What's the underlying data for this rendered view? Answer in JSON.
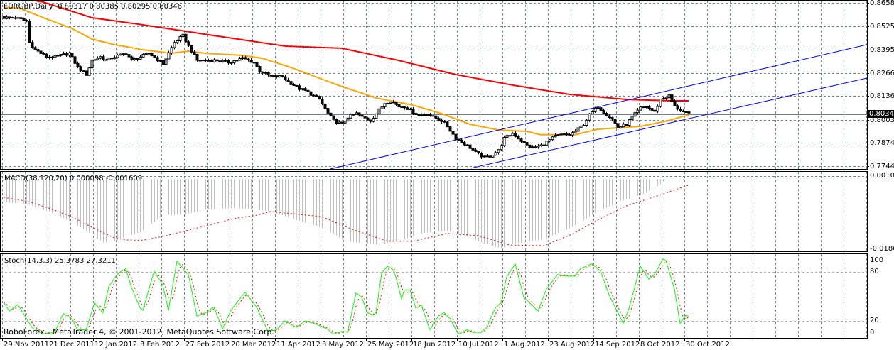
{
  "window": {
    "symbol_label": "EURGBP,Daily",
    "ohlc": "0.80317 0.80385 0.80295 0.80346",
    "copyright": "RoboForex - MetaTrader 4, © 2001-2012, MetaQuotes Software Corp."
  },
  "colors": {
    "bull_body": "#ffffff",
    "bear_body": "#000000",
    "ma_fast": "#ffa500",
    "ma_slow": "#ff0000",
    "channel": "#0000ff",
    "grid": "#708090",
    "macd_hist": "#c0c0c0",
    "signal": "#ff0000",
    "stoch_k": "#00ff00",
    "stoch_d": "#ff0000"
  },
  "price_axis": {
    "labels": [
      "0.86580",
      "0.85250",
      "0.83955",
      "0.82660",
      "0.81365",
      "0.80035",
      "0.78740",
      "0.77445"
    ],
    "current": "0.80346"
  },
  "macd_axis": {
    "labels": [
      "0.00102",
      "-0.01864"
    ]
  },
  "stoch_axis": {
    "labels": [
      "100",
      "80",
      "20",
      "0"
    ]
  },
  "macd": {
    "label": "MACD(38,120,20)",
    "main": "0.000098",
    "signal": "-0.001609"
  },
  "stoch": {
    "label": "Stoch(14,3,3)",
    "k": "25.3783",
    "d": "27.3211"
  },
  "dates": [
    "29 Nov 2011",
    "21 Dec 2011",
    "12 Jan 2012",
    "3 Feb 2012",
    "27 Feb 2012",
    "20 Mar 2012",
    "11 Apr 2012",
    "3 May 2012",
    "25 May 2012",
    "18 Jun 2012",
    "10 Jul 2012",
    "1 Aug 2012",
    "23 Aug 2012",
    "14 Sep 2012",
    "8 Oct 2012",
    "30 Oct 2012"
  ],
  "chart_data": {
    "type": "candlestick",
    "title": "EURGBP,Daily",
    "bars": 242,
    "ylim": [
      0.77445,
      0.8658
    ],
    "close_keyframes": [
      [
        0,
        0.8575
      ],
      [
        4,
        0.8575
      ],
      [
        8,
        0.8555
      ],
      [
        9,
        0.8436
      ],
      [
        11,
        0.8396
      ],
      [
        15,
        0.8356
      ],
      [
        18,
        0.8356
      ],
      [
        23,
        0.8376
      ],
      [
        26,
        0.8297
      ],
      [
        29,
        0.8257
      ],
      [
        31,
        0.8336
      ],
      [
        34,
        0.8356
      ],
      [
        36,
        0.8336
      ],
      [
        39,
        0.8356
      ],
      [
        43,
        0.8376
      ],
      [
        45,
        0.8336
      ],
      [
        48,
        0.8356
      ],
      [
        51,
        0.8376
      ],
      [
        56,
        0.8317
      ],
      [
        60,
        0.8436
      ],
      [
        63,
        0.8475
      ],
      [
        65,
        0.8416
      ],
      [
        68,
        0.8336
      ],
      [
        71,
        0.8336
      ],
      [
        75,
        0.8336
      ],
      [
        79,
        0.8325
      ],
      [
        84,
        0.8348
      ],
      [
        88,
        0.8325
      ],
      [
        90,
        0.8277
      ],
      [
        94,
        0.8245
      ],
      [
        98,
        0.8245
      ],
      [
        100,
        0.8217
      ],
      [
        104,
        0.8178
      ],
      [
        106,
        0.8166
      ],
      [
        109,
        0.8138
      ],
      [
        111,
        0.8118
      ],
      [
        114,
        0.8039
      ],
      [
        116,
        0.7999
      ],
      [
        119,
        0.7979
      ],
      [
        121,
        0.8019
      ],
      [
        124,
        0.8039
      ],
      [
        126,
        0.8019
      ],
      [
        129,
        0.7999
      ],
      [
        131,
        0.8039
      ],
      [
        134,
        0.8098
      ],
      [
        136,
        0.811
      ],
      [
        139,
        0.8078
      ],
      [
        141,
        0.8078
      ],
      [
        144,
        0.8047
      ],
      [
        146,
        0.8027
      ],
      [
        149,
        0.8039
      ],
      [
        151,
        0.8019
      ],
      [
        154,
        0.7999
      ],
      [
        156,
        0.7967
      ],
      [
        159,
        0.79
      ],
      [
        161,
        0.788
      ],
      [
        164,
        0.7848
      ],
      [
        166,
        0.782
      ],
      [
        169,
        0.7793
      ],
      [
        171,
        0.7801
      ],
      [
        174,
        0.7832
      ],
      [
        176,
        0.79
      ],
      [
        179,
        0.7928
      ],
      [
        181,
        0.79
      ],
      [
        184,
        0.786
      ],
      [
        186,
        0.7848
      ],
      [
        189,
        0.786
      ],
      [
        191,
        0.788
      ],
      [
        194,
        0.7912
      ],
      [
        196,
        0.792
      ],
      [
        199,
        0.792
      ],
      [
        201,
        0.7939
      ],
      [
        204,
        0.7979
      ],
      [
        206,
        0.8031
      ],
      [
        209,
        0.8078
      ],
      [
        211,
        0.8047
      ],
      [
        214,
        0.8007
      ],
      [
        216,
        0.7959
      ],
      [
        219,
        0.7979
      ],
      [
        221,
        0.8019
      ],
      [
        224,
        0.807
      ],
      [
        226,
        0.8078
      ],
      [
        229,
        0.8047
      ],
      [
        231,
        0.8118
      ],
      [
        234,
        0.8138
      ],
      [
        236,
        0.8078
      ],
      [
        239,
        0.8047
      ],
      [
        241,
        0.80346
      ]
    ],
    "ma_slow_keyframes": [
      [
        0,
        0.87
      ],
      [
        14,
        0.8662
      ],
      [
        31,
        0.8575
      ],
      [
        49,
        0.8535
      ],
      [
        74,
        0.8475
      ],
      [
        99,
        0.8416
      ],
      [
        119,
        0.8404
      ],
      [
        139,
        0.8336
      ],
      [
        159,
        0.8257
      ],
      [
        179,
        0.8198
      ],
      [
        199,
        0.8146
      ],
      [
        219,
        0.8118
      ],
      [
        234,
        0.811
      ],
      [
        241,
        0.811
      ]
    ],
    "ma_fast_keyframes": [
      [
        0,
        0.8634
      ],
      [
        6,
        0.8626
      ],
      [
        14,
        0.8575
      ],
      [
        24,
        0.8515
      ],
      [
        31,
        0.8456
      ],
      [
        39,
        0.8424
      ],
      [
        49,
        0.8396
      ],
      [
        59,
        0.8376
      ],
      [
        65,
        0.8388
      ],
      [
        71,
        0.8376
      ],
      [
        84,
        0.8364
      ],
      [
        91,
        0.8348
      ],
      [
        101,
        0.8297
      ],
      [
        111,
        0.8237
      ],
      [
        119,
        0.819
      ],
      [
        131,
        0.8126
      ],
      [
        144,
        0.8086
      ],
      [
        154,
        0.8039
      ],
      [
        164,
        0.7979
      ],
      [
        174,
        0.7947
      ],
      [
        184,
        0.7939
      ],
      [
        189,
        0.792
      ],
      [
        201,
        0.792
      ],
      [
        209,
        0.7951
      ],
      [
        216,
        0.7959
      ],
      [
        224,
        0.7967
      ],
      [
        234,
        0.7999
      ],
      [
        239,
        0.8023
      ],
      [
        241,
        0.8027
      ]
    ],
    "channel_lines": [
      [
        [
          115,
          0.7729
        ],
        [
          303.75,
          0.8424
        ]
      ],
      [
        [
          164.5,
          0.7733
        ],
        [
          303.75,
          0.8237
        ]
      ]
    ],
    "macd": {
      "ylim": [
        -0.01864,
        0.00102
      ],
      "hist_keyframes": [
        [
          0,
          -0.0062
        ],
        [
          8,
          -0.0066
        ],
        [
          11,
          -0.0076
        ],
        [
          16,
          -0.0087
        ],
        [
          24,
          -0.0116
        ],
        [
          31,
          -0.0148
        ],
        [
          35,
          -0.0171
        ],
        [
          39,
          -0.0167
        ],
        [
          43,
          -0.0154
        ],
        [
          48,
          -0.0143
        ],
        [
          56,
          -0.0097
        ],
        [
          64,
          -0.0095
        ],
        [
          71,
          -0.0082
        ],
        [
          81,
          -0.0078
        ],
        [
          89,
          -0.0082
        ],
        [
          94,
          -0.0087
        ],
        [
          103,
          -0.011
        ],
        [
          113,
          -0.0133
        ],
        [
          120,
          -0.0167
        ],
        [
          132,
          -0.0177
        ],
        [
          142,
          -0.0158
        ],
        [
          148,
          -0.0144
        ],
        [
          156,
          -0.0139
        ],
        [
          161,
          -0.0148
        ],
        [
          169,
          -0.0173
        ],
        [
          175,
          -0.0186
        ],
        [
          180,
          -0.0173
        ],
        [
          190,
          -0.0162
        ],
        [
          200,
          -0.0129
        ],
        [
          208,
          -0.0091
        ],
        [
          217,
          -0.0059
        ],
        [
          225,
          -0.004
        ],
        [
          230,
          -0.0019
        ],
        [
          233,
          0.0001
        ],
        [
          241,
          9.8e-05
        ]
      ],
      "signal_keyframes": [
        [
          0,
          -0.0049
        ],
        [
          8,
          -0.0059
        ],
        [
          16,
          -0.0078
        ],
        [
          24,
          -0.0101
        ],
        [
          31,
          -0.0129
        ],
        [
          39,
          -0.0158
        ],
        [
          44,
          -0.0164
        ],
        [
          49,
          -0.0164
        ],
        [
          56,
          -0.0154
        ],
        [
          64,
          -0.0139
        ],
        [
          74,
          -0.012
        ],
        [
          81,
          -0.0106
        ],
        [
          89,
          -0.0097
        ],
        [
          94,
          -0.0087
        ],
        [
          112,
          -0.0101
        ],
        [
          122,
          -0.0133
        ],
        [
          135,
          -0.0167
        ],
        [
          144,
          -0.0167
        ],
        [
          156,
          -0.0146
        ],
        [
          167,
          -0.0152
        ],
        [
          178,
          -0.0177
        ],
        [
          190,
          -0.0179
        ],
        [
          200,
          -0.0148
        ],
        [
          209,
          -0.011
        ],
        [
          219,
          -0.0072
        ],
        [
          232,
          -0.004
        ],
        [
          241,
          -0.001609
        ]
      ]
    },
    "stochastic": {
      "ylim": [
        0,
        100
      ],
      "levels": [
        20,
        80
      ],
      "k_keyframes": [
        [
          0,
          43
        ],
        [
          2,
          32
        ],
        [
          5,
          40
        ],
        [
          7,
          29
        ],
        [
          10,
          12
        ],
        [
          14,
          4
        ],
        [
          18,
          6
        ],
        [
          21,
          29
        ],
        [
          24,
          23
        ],
        [
          26,
          9
        ],
        [
          29,
          9
        ],
        [
          32,
          42
        ],
        [
          35,
          30
        ],
        [
          37,
          62
        ],
        [
          40,
          77
        ],
        [
          41,
          80
        ],
        [
          43,
          84
        ],
        [
          45,
          61
        ],
        [
          48,
          36
        ],
        [
          49,
          33
        ],
        [
          53,
          81
        ],
        [
          56,
          64
        ],
        [
          58,
          33
        ],
        [
          61,
          93
        ],
        [
          65,
          77
        ],
        [
          68,
          26
        ],
        [
          71,
          30
        ],
        [
          74,
          37
        ],
        [
          77,
          10
        ],
        [
          80,
          33
        ],
        [
          84,
          51
        ],
        [
          85,
          55
        ],
        [
          89,
          37
        ],
        [
          93,
          7
        ],
        [
          96,
          9
        ],
        [
          99,
          20
        ],
        [
          103,
          12
        ],
        [
          106,
          20
        ],
        [
          110,
          16
        ],
        [
          114,
          10
        ],
        [
          116,
          4
        ],
        [
          119,
          7
        ],
        [
          121,
          6
        ],
        [
          124,
          54
        ],
        [
          126,
          49
        ],
        [
          128,
          30
        ],
        [
          130,
          27
        ],
        [
          131,
          30
        ],
        [
          133,
          78
        ],
        [
          135,
          87
        ],
        [
          137,
          83
        ],
        [
          138,
          74
        ],
        [
          140,
          47
        ],
        [
          141,
          58
        ],
        [
          143,
          58
        ],
        [
          145,
          36
        ],
        [
          147,
          39
        ],
        [
          150,
          9
        ],
        [
          153,
          26
        ],
        [
          155,
          30
        ],
        [
          157,
          23
        ],
        [
          160,
          4
        ],
        [
          163,
          9
        ],
        [
          165,
          6
        ],
        [
          168,
          6
        ],
        [
          170,
          12
        ],
        [
          173,
          36
        ],
        [
          175,
          42
        ],
        [
          177,
          74
        ],
        [
          180,
          90
        ],
        [
          183,
          49
        ],
        [
          186,
          39
        ],
        [
          188,
          32
        ],
        [
          191,
          59
        ],
        [
          195,
          77
        ],
        [
          197,
          75
        ],
        [
          201,
          75
        ],
        [
          203,
          84
        ],
        [
          207,
          90
        ],
        [
          210,
          81
        ],
        [
          213,
          52
        ],
        [
          218,
          17
        ],
        [
          220,
          35
        ],
        [
          224,
          87
        ],
        [
          227,
          71
        ],
        [
          229,
          77
        ],
        [
          232,
          96
        ],
        [
          233,
          94
        ],
        [
          236,
          59
        ],
        [
          238,
          17
        ],
        [
          240,
          27
        ],
        [
          241,
          25.3783
        ]
      ]
    }
  }
}
